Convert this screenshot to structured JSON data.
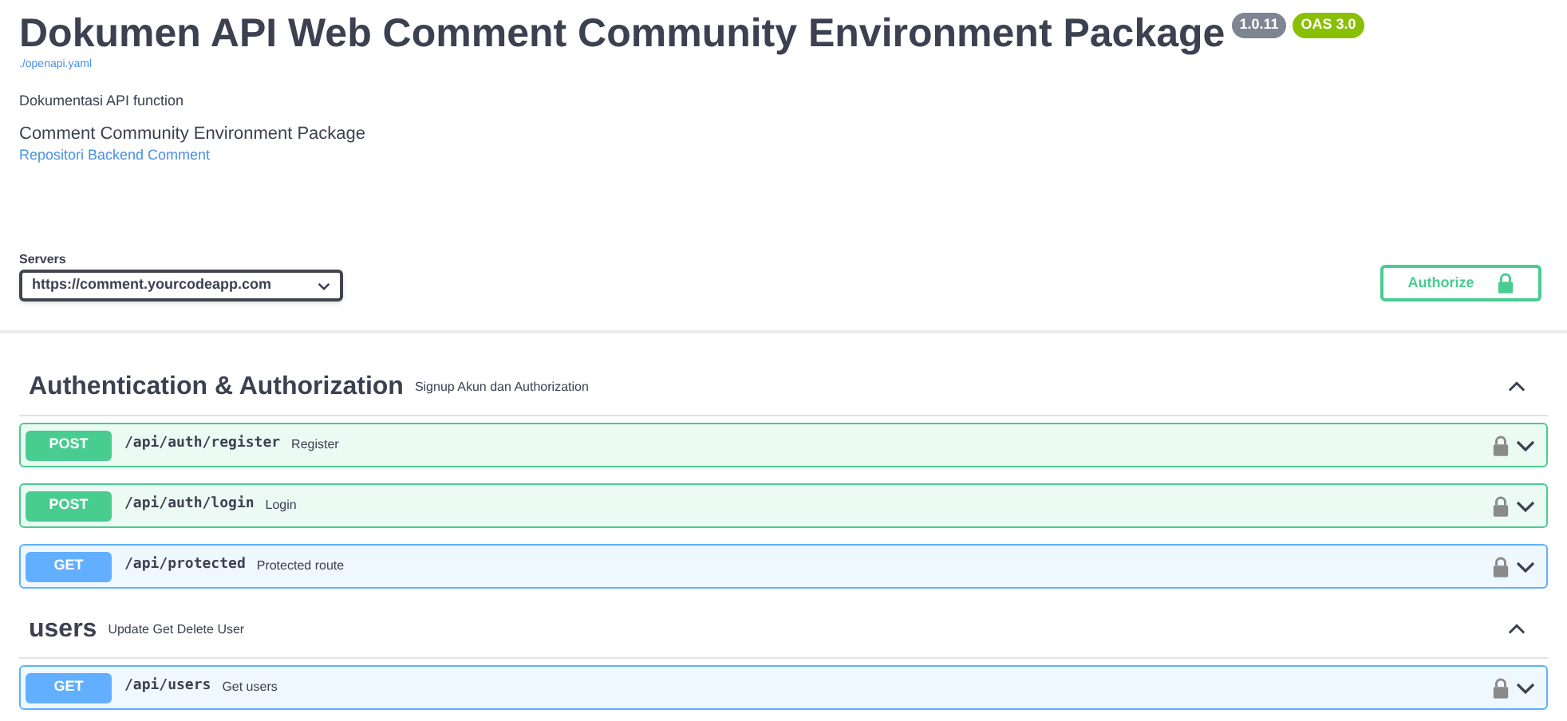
{
  "info": {
    "title": "Dokumen API Web Comment Community Environment Package",
    "version": "1.0.11",
    "oas": "OAS 3.0",
    "spec_link": "./openapi.yaml",
    "description": "Dokumentasi API function",
    "subtitle": "Comment Community Environment Package",
    "repo_link": "Repositori Backend Comment"
  },
  "servers": {
    "label": "Servers",
    "value": "https://comment.yourcodeapp.com"
  },
  "authorize": {
    "label": "Authorize"
  },
  "sections": [
    {
      "name": "Authentication & Authorization",
      "description": "Signup Akun dan Authorization",
      "expanded": true,
      "operations": [
        {
          "method": "POST",
          "kind": "post",
          "path": "/api/auth/register",
          "summary": "Register"
        },
        {
          "method": "POST",
          "kind": "post",
          "path": "/api/auth/login",
          "summary": "Login"
        },
        {
          "method": "GET",
          "kind": "get",
          "path": "/api/protected",
          "summary": "Protected route"
        }
      ]
    },
    {
      "name": "users",
      "description": "Update Get Delete User",
      "expanded": true,
      "operations": [
        {
          "method": "GET",
          "kind": "get",
          "path": "/api/users",
          "summary": "Get users"
        }
      ]
    }
  ]
}
